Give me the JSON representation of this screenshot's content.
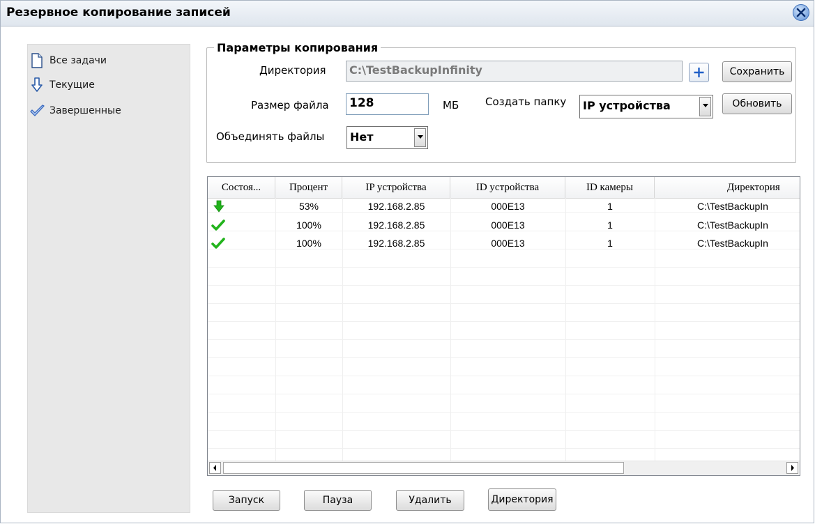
{
  "window": {
    "title": "Резервное копирование записей",
    "close_icon": "close-icon"
  },
  "sidebar": {
    "items": [
      {
        "label": "Все задачи",
        "icon": "document-icon"
      },
      {
        "label": "Текущие",
        "icon": "arrow-down-icon"
      },
      {
        "label": "Завершенные",
        "icon": "checkmark-icon"
      }
    ]
  },
  "params": {
    "legend": "Параметры копирования",
    "directory_label": "Директория",
    "directory_value": "C:\\TestBackupInfinity",
    "save_label": "Сохранить",
    "filesize_label": "Размер файла",
    "filesize_value": "128",
    "filesize_unit": "МБ",
    "create_folder_label": "Создать папку",
    "create_folder_value": "IP устройства",
    "refresh_label": "Обновить",
    "merge_label": "Объединять файлы",
    "merge_value": "Нет"
  },
  "table": {
    "columns": [
      "Состоя...",
      "Процент",
      "IP устройства",
      "ID устройства",
      "ID камеры",
      "Директория"
    ],
    "rows": [
      {
        "status": "downloading",
        "percent": "53%",
        "ip": "192.168.2.85",
        "device_id": "000E13",
        "camera_id": "1",
        "directory": "C:\\TestBackupIn"
      },
      {
        "status": "done",
        "percent": "100%",
        "ip": "192.168.2.85",
        "device_id": "000E13",
        "camera_id": "1",
        "directory": "C:\\TestBackupIn"
      },
      {
        "status": "done",
        "percent": "100%",
        "ip": "192.168.2.85",
        "device_id": "000E13",
        "camera_id": "1",
        "directory": "C:\\TestBackupIn"
      }
    ]
  },
  "buttons": {
    "start": "Запуск",
    "pause": "Пауза",
    "delete": "Удалить",
    "directory": "Директория"
  },
  "colors": {
    "status_green": "#22b31c",
    "accent_blue": "#2f6fd0"
  }
}
